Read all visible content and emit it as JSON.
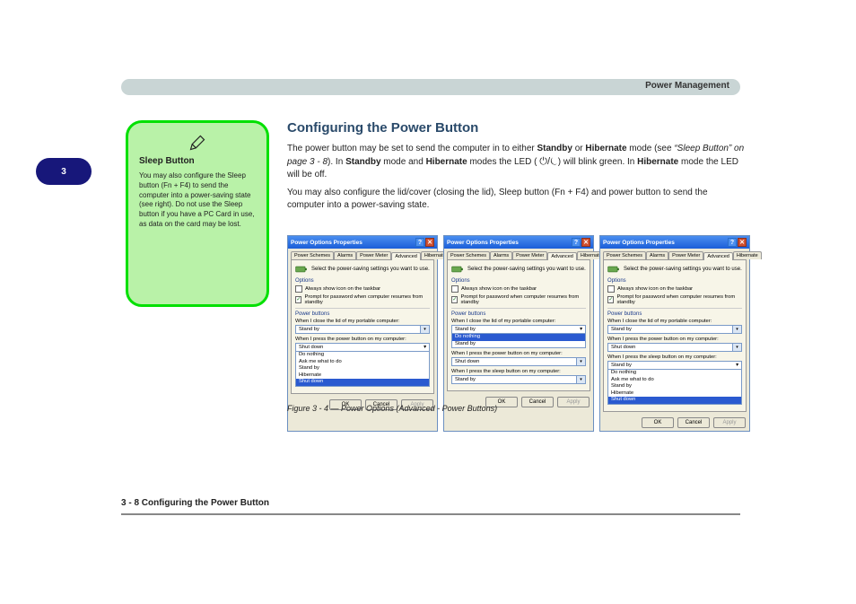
{
  "header": {
    "chapter_title": "Power Management"
  },
  "page_badge": "3",
  "note": {
    "title": "Sleep Button",
    "body": "You may also configure the Sleep button (Fn + F4) to send the computer into a power-saving state (see right). Do not use the Sleep button if you have a PC Card in use, as data on the card may be lost."
  },
  "section": {
    "heading": "Configuring the Power Button",
    "para1_prefix": "The power button may be set to send the computer in to either ",
    "standby": "Standby",
    "or_word": " or ",
    "hibernate": "Hibernate",
    "para1_suffix1": " mode (see ",
    "sidebar_ref": "“Sleep Button” on page 3 - 8",
    "para1_suffix2": "). In ",
    "standby2": "Standby",
    "para1_suffix3": " mode and ",
    "hibernate2": "Hibernate",
    "para1_suffix4": " modes the LED ( ",
    "icon_unicode": "⏻/⏾",
    "para1_suffix5": ") will blink green. In ",
    "hibernate3": "Hibernate",
    "para1_suffix6": " mode the LED will be off.",
    "para2": "You may also configure the lid/cover (closing the lid), Sleep button (Fn + F4) and power button to send the computer into a power-saving state."
  },
  "dialogs": [
    {
      "title": "Power Options Properties",
      "tabs": [
        "Power Schemes",
        "Alarms",
        "Power Meter",
        "Advanced",
        "Hibernate"
      ],
      "active_tab_index": 3,
      "intro": "Select the power-saving settings you want to use.",
      "options_label": "Options",
      "cb1": {
        "checked": false,
        "label": "Always show icon on the taskbar"
      },
      "cb2": {
        "checked": true,
        "label": "Prompt for password when computer resumes from standby"
      },
      "pb_label": "Power buttons",
      "lid_label": "When I close the lid of my portable computer:",
      "lid_value": "Stand by",
      "power_label": "When I press the power button on my computer:",
      "power_value": "Shut down",
      "power_open": true,
      "power_options": [
        "Do nothing",
        "Ask me what to do",
        "Stand by",
        "Hibernate",
        "Shut down"
      ],
      "power_highlight_index": 4,
      "sleep_label": "",
      "sleep_value": "",
      "ok": "OK",
      "cancel": "Cancel",
      "apply": "Apply"
    },
    {
      "title": "Power Options Properties",
      "tabs": [
        "Power Schemes",
        "Alarms",
        "Power Meter",
        "Advanced",
        "Hibernate"
      ],
      "active_tab_index": 3,
      "intro": "Select the power-saving settings you want to use.",
      "options_label": "Options",
      "cb1": {
        "checked": false,
        "label": "Always show icon on the taskbar"
      },
      "cb2": {
        "checked": true,
        "label": "Prompt for password when computer resumes from standby"
      },
      "pb_label": "Power buttons",
      "lid_label": "When I close the lid of my portable computer:",
      "lid_value": "Stand by",
      "lid_open": true,
      "lid_options": [
        "Do nothing",
        "Stand by"
      ],
      "lid_highlight_index": 0,
      "power_label": "When I press the power button on my computer:",
      "power_value": "Shut down",
      "sleep_label": "When I press the sleep button on my computer:",
      "sleep_value": "Stand by",
      "ok": "OK",
      "cancel": "Cancel",
      "apply": "Apply"
    },
    {
      "title": "Power Options Properties",
      "tabs": [
        "Power Schemes",
        "Alarms",
        "Power Meter",
        "Advanced",
        "Hibernate"
      ],
      "active_tab_index": 3,
      "intro": "Select the power-saving settings you want to use.",
      "options_label": "Options",
      "cb1": {
        "checked": false,
        "label": "Always show icon on the taskbar"
      },
      "cb2": {
        "checked": true,
        "label": "Prompt for password when computer resumes from standby"
      },
      "pb_label": "Power buttons",
      "lid_label": "When I close the lid of my portable computer:",
      "lid_value": "Stand by",
      "power_label": "When I press the power button on my computer:",
      "power_value": "Shut down",
      "sleep_label": "When I press the sleep button on my computer:",
      "sleep_value": "Stand by",
      "sleep_open": true,
      "sleep_options": [
        "Do nothing",
        "Ask me what to do",
        "Stand by",
        "Hibernate",
        "Shut down"
      ],
      "sleep_highlight_index": 4,
      "ok": "OK",
      "cancel": "Cancel",
      "apply": "Apply"
    }
  ],
  "figure_caption": "Figure 3 - 4 — Power Options (Advanced - Power Buttons)",
  "footer": "3 - 8 Configuring the Power Button",
  "icons": {
    "chevron_down": "▾",
    "check": "✓",
    "close_x": "✕",
    "help_q": "?"
  }
}
